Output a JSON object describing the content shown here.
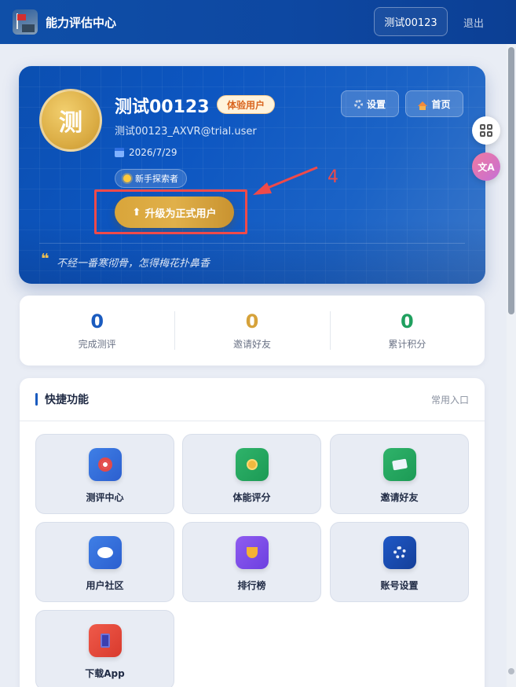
{
  "header": {
    "app_title": "能力评估中心",
    "user_chip": "测试00123",
    "logout": "退出"
  },
  "profile": {
    "avatar_char": "测",
    "name": "测试00123",
    "badge": "体验用户",
    "email": "测试00123_AXVR@trial.user",
    "date": "2026/7/29",
    "tag": "新手探索者",
    "upgrade_button": "升级为正式用户",
    "settings_button": "设置",
    "home_button": "首页",
    "quote": "不经一番寒彻骨，怎得梅花扑鼻香"
  },
  "annotation": {
    "number": "4",
    "color": "#ef4a4a"
  },
  "stats": [
    {
      "value": "0",
      "label": "完成测评"
    },
    {
      "value": "0",
      "label": "邀请好友"
    },
    {
      "value": "0",
      "label": "累计积分"
    }
  ],
  "quick": {
    "title": "快捷功能",
    "subtitle": "常用入口",
    "items": [
      {
        "label": "测评中心",
        "icon": "target-icon"
      },
      {
        "label": "体能评分",
        "icon": "medal-icon"
      },
      {
        "label": "邀请好友",
        "icon": "ticket-icon"
      },
      {
        "label": "用户社区",
        "icon": "chat-bubble-icon"
      },
      {
        "label": "排行榜",
        "icon": "trophy-icon"
      },
      {
        "label": "账号设置",
        "icon": "gear-icon"
      },
      {
        "label": "下载App",
        "icon": "phone-icon"
      }
    ]
  },
  "colors": {
    "header": "#0d47a1",
    "accent_gold": "#d6a23a",
    "accent_green": "#20a05f",
    "accent_blue": "#1a5bbf"
  }
}
